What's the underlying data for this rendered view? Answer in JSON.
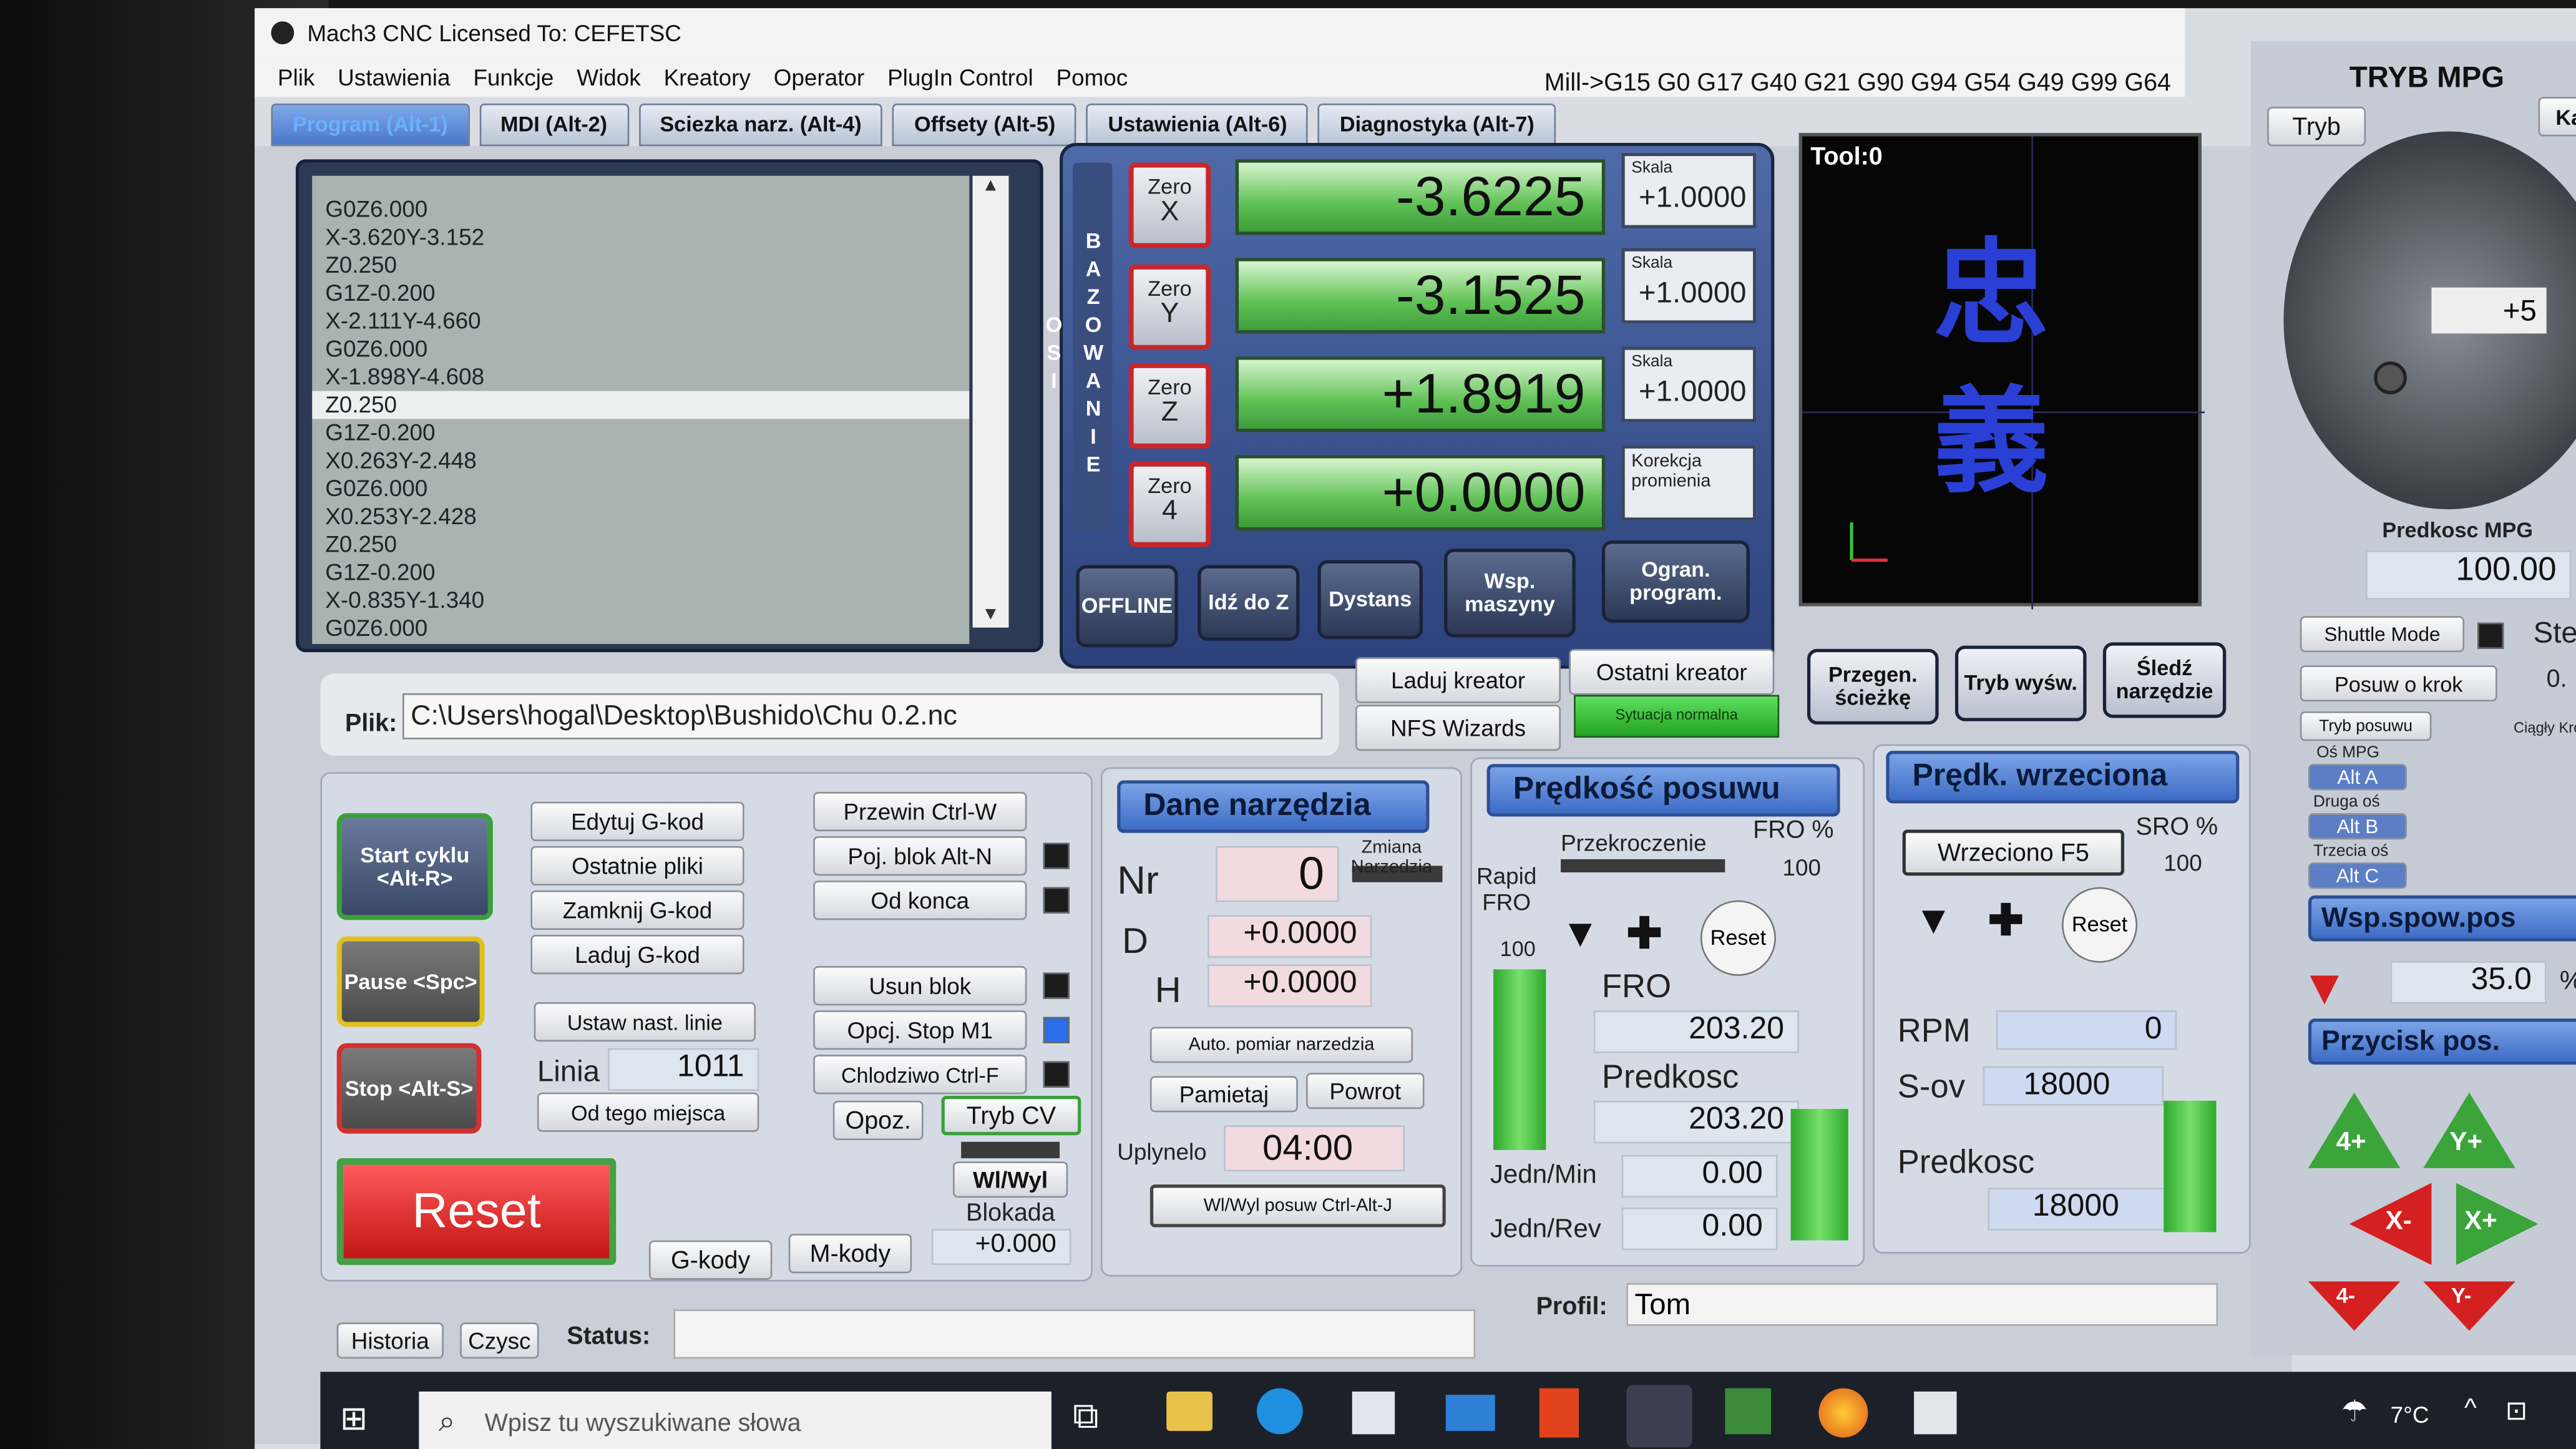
{
  "window": {
    "title": "Mach3 CNC  Licensed To: CEFETSC"
  },
  "menu": [
    "Plik",
    "Ustawienia",
    "Funkcje",
    "Widok",
    "Kreatory",
    "Operator",
    "PlugIn Control",
    "Pomoc"
  ],
  "tabs": [
    "Program (Alt-1)",
    "MDI (Alt-2)",
    "Sciezka narz. (Alt-4)",
    "Offsety (Alt-5)",
    "Ustawienia (Alt-6)",
    "Diagnostyka (Alt-7)"
  ],
  "gcode_status": "Mill->G15  G0 G17 G40 G21 G90 G94 G54 G49 G99 G64",
  "gcode_lines": [
    "G0Z6.000",
    "X-3.620Y-3.152",
    "Z0.250",
    "G1Z-0.200",
    "X-2.111Y-4.660",
    "G0Z6.000",
    "X-1.898Y-4.608",
    "Z0.250",
    "G1Z-0.200",
    "X0.263Y-2.448",
    "G0Z6.000",
    "X0.253Y-2.428",
    "Z0.250",
    "G1Z-0.200",
    "X-0.835Y-1.340",
    "G0Z6.000"
  ],
  "file": {
    "label": "Plik:",
    "path": "C:\\Users\\hogal\\Desktop\\Bushido\\Chu 0.2.nc"
  },
  "dro": {
    "vertical_label": "BAZOWANIE OSI",
    "axes": [
      {
        "zero": "Zero",
        "axis": "X",
        "value": "-3.6225",
        "scale_label": "Skala",
        "scale": "+1.0000"
      },
      {
        "zero": "Zero",
        "axis": "Y",
        "value": "-3.1525",
        "scale_label": "Skala",
        "scale": "+1.0000"
      },
      {
        "zero": "Zero",
        "axis": "Z",
        "value": "+1.8919",
        "scale_label": "Skala",
        "scale": "+1.0000"
      },
      {
        "zero": "Zero",
        "axis": "4",
        "value": "+0.0000",
        "scale_label": "Korekcja promienia",
        "scale": ""
      }
    ],
    "buttons": [
      "OFFLINE",
      "Idź do Z",
      "Dystans",
      "Wsp. maszyny",
      "Ogran. program."
    ]
  },
  "toolpath": {
    "label": "Tool:0"
  },
  "wizards": {
    "load": "Laduj kreator",
    "last": "Ostatni kreator",
    "nfs": "NFS Wizards",
    "status": "Sytuacja normalna"
  },
  "view_buttons": [
    "Przegen. ścieżkę",
    "Tryb wyśw.",
    "Śledź narzędzie"
  ],
  "program_buttons": {
    "start": "Start cyklu <Alt-R>",
    "pause": "Pause <Spc>",
    "stop": "Stop <Alt-S>",
    "edit": "Edytuj G-kod",
    "recent": "Ostatnie pliki",
    "close": "Zamknij G-kod",
    "load": "Laduj G-kod",
    "set_next": "Ustaw nast. linie",
    "line_label": "Linia",
    "line_value": "1011",
    "from_here": "Od tego miejsca",
    "rewind": "Przewin Ctrl-W",
    "single": "Poj. blok Alt-N",
    "from_end": "Od konca",
    "delete_block": "Usun blok",
    "opt_stop": "Opcj. Stop M1",
    "coolant": "Chlodziwo Ctrl-F",
    "delay": "Opoz.",
    "cv_mode": "Tryb CV",
    "toggle": "Wl/Wyl",
    "lock_label": "Blokada",
    "lock_value": "+0.000",
    "reset": "Reset",
    "gcodes": "G-kody",
    "mcodes": "M-kody"
  },
  "tool_data": {
    "title": "Dane narzędzia",
    "nr_label": "Nr",
    "nr": "0",
    "change_label": "Zmiana Narzedzia",
    "d_label": "D",
    "d": "+0.0000",
    "h_label": "H",
    "h": "+0.0000",
    "auto": "Auto. pomiar narzedzia",
    "remember": "Pamietaj",
    "return": "Powrot",
    "elapsed_label": "Uplynelo",
    "elapsed": "04:00",
    "jog_toggle": "Wl/Wyl posuw Ctrl-Alt-J"
  },
  "feed": {
    "title": "Prędkość posuwu",
    "override_label": "Przekroczenie",
    "fro_pct_label": "FRO %",
    "fro_pct": "100",
    "rapid_label": "Rapid FRO",
    "rapid_value": "100",
    "reset": "Reset",
    "fro_label": "FRO",
    "fro": "203.20",
    "speed_label": "Predkosc",
    "speed": "203.20",
    "units_min_label": "Jedn/Min",
    "units_min": "0.00",
    "units_rev_label": "Jedn/Rev",
    "units_rev": "0.00"
  },
  "spindle": {
    "title": "Prędk. wrzeciona",
    "button": "Wrzeciono F5",
    "sro_label": "SRO %",
    "sro": "100",
    "reset": "Reset",
    "rpm_label": "RPM",
    "rpm": "0",
    "sov_label": "S-ov",
    "sov": "18000",
    "speed_label": "Predkosc",
    "speed": "18000"
  },
  "mpg": {
    "title": "TRYB MPG",
    "tryb": "Tryb",
    "kali": "Kali",
    "step": "+5",
    "speed_label": "Predkosc MPG",
    "speed": "100.00",
    "shuttle": "Shuttle Mode",
    "ste": "Ste",
    "jog_step": "Posuw o krok",
    "jog_val": "0.",
    "jog_mode": "Tryb posuwu",
    "continuous": "Ciągły Krok",
    "axis_mpg": "Oś MPG",
    "alt_a": "Alt A",
    "axis_two": "Druga oś",
    "alt_b": "Alt B",
    "axis_three": "Trzecia oś",
    "alt_c": "Alt C",
    "jog_speed_title": "Wsp.spow.pos",
    "jog_speed": "35.0",
    "jog_pct": "%",
    "buttons_title": "Przycisk pos.",
    "arrows": [
      "4+",
      "Y+",
      "X-",
      "X+",
      "4-",
      "Y-"
    ]
  },
  "bottom": {
    "history": "Historia",
    "clear": "Czysc",
    "status_label": "Status:",
    "profile_label": "Profil:",
    "profile": "Tom"
  },
  "taskbar": {
    "search_placeholder": "Wpisz tu wyszukiwane słowa",
    "temp": "7°C"
  },
  "colors": {
    "dro_green": "#5fc155",
    "reset_red": "#c01515",
    "panel_blue": "#3d6cc6",
    "toolpath_blue": "#2a3fd6"
  }
}
